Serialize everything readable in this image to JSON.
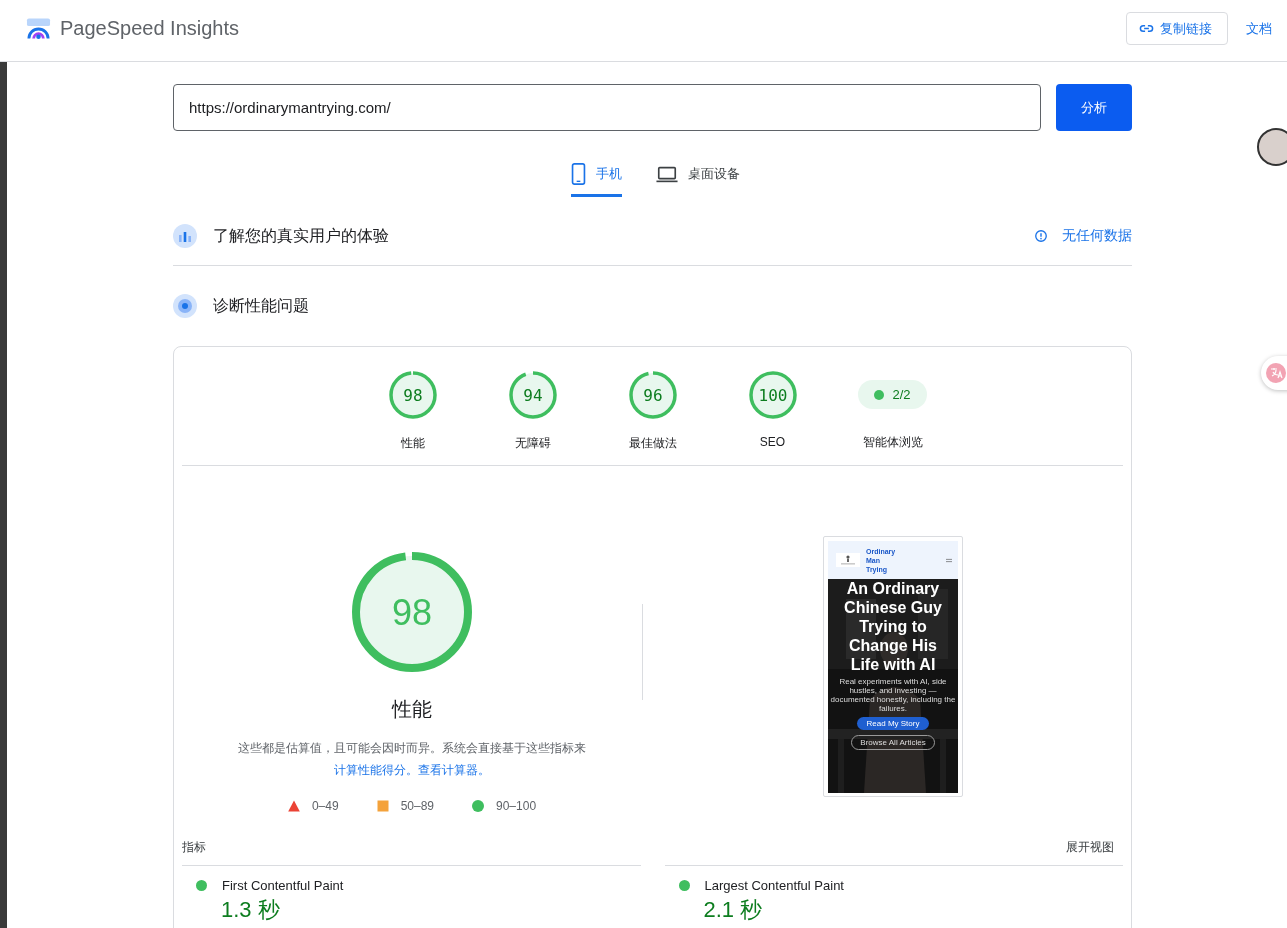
{
  "header": {
    "title": "PageSpeed Insights",
    "copy_link": "复制链接",
    "docs": "文档"
  },
  "url_field": {
    "value": "https://ordinarymantrying.com/"
  },
  "analyze_button": "分析",
  "device_tabs": [
    {
      "label": "手机",
      "kind": "phone",
      "selected": true
    },
    {
      "label": "桌面设备",
      "kind": "desktop",
      "selected": false
    }
  ],
  "field_data": {
    "title": "了解您的真实用户的体验",
    "status": "无任何数据"
  },
  "lab_data": {
    "title": "诊断性能问题"
  },
  "categories": [
    {
      "kind": "gauge",
      "score": "98",
      "level": 0.98,
      "label": "性能"
    },
    {
      "kind": "gauge",
      "score": "94",
      "level": 0.94,
      "label": "无障碍"
    },
    {
      "kind": "gauge",
      "score": "96",
      "level": 0.96,
      "label": "最佳做法"
    },
    {
      "kind": "gauge",
      "score": "100",
      "level": 1,
      "label": "SEO"
    },
    {
      "kind": "pill",
      "score": "2/2",
      "label": "智能体浏览"
    }
  ],
  "performance": {
    "score": "98",
    "level": 0.98,
    "title": "性能",
    "description": "这些都是估算值，且可能会因时而异。系统会直接基于这些指标来",
    "link_1": "计算性能得分。",
    "link_2": "查看计算器。"
  },
  "legend": [
    {
      "kind": "fail",
      "label": "0–49"
    },
    {
      "kind": "average",
      "label": "50–89"
    },
    {
      "kind": "pass",
      "label": "90–100"
    }
  ],
  "screenshot": {
    "site_name": "Ordinary Man Trying",
    "headline": "An Ordinary Chinese Guy Trying to Change His Life with AI",
    "subtitle": "Real experiments with AI, side hustles, and investing — documented honestly, including the failures.",
    "primary_button": "Read My Story",
    "secondary_button": "Browse All Articles"
  },
  "metrics": {
    "title": "指标",
    "expand": "展开视图",
    "items": [
      {
        "name": "First Contentful Paint",
        "value": "1.3 秒"
      },
      {
        "name": "Largest Contentful Paint",
        "value": "2.1 秒"
      }
    ]
  }
}
